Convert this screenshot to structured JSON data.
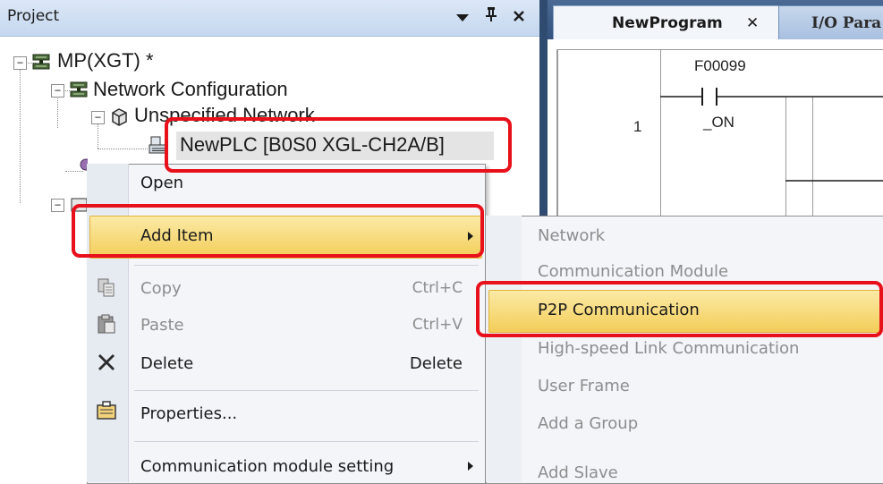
{
  "project_pane": {
    "title": "Project",
    "buttons": [
      "▼",
      "ᵖ",
      "✕"
    ]
  },
  "tree": {
    "root": "MP(XGT) *",
    "network_config": "Network Configuration",
    "unspecified_network": "Unspecified Network",
    "plc": "NewPLC  [B0S0 XGL-CH2A/B]"
  },
  "editor": {
    "tabs": [
      {
        "label": "NewProgram",
        "close": "✕"
      },
      {
        "label": "I/O Para"
      }
    ],
    "rung_number": "1",
    "contact_address": "F00099",
    "contact_name": "_ON"
  },
  "context_menu": {
    "items": [
      {
        "label": "Open",
        "shortcut": "",
        "disabled": false,
        "icon": ""
      },
      {
        "label": "Add Item",
        "shortcut": "",
        "disabled": false,
        "highlighted": true,
        "submenu": true,
        "icon": ""
      },
      {
        "label": "Copy",
        "shortcut": "Ctrl+C",
        "disabled": true,
        "icon": "copy-icon"
      },
      {
        "label": "Paste",
        "shortcut": "Ctrl+V",
        "disabled": true,
        "icon": "paste-icon"
      },
      {
        "label": "Delete",
        "shortcut": "Delete",
        "disabled": false,
        "icon": "delete-x-icon"
      },
      {
        "label": "Properties...",
        "shortcut": "",
        "disabled": false,
        "icon": "properties-icon"
      },
      {
        "label": "Communication module setting",
        "shortcut": "",
        "disabled": false,
        "submenu": true,
        "icon": ""
      }
    ]
  },
  "submenu": {
    "items": [
      {
        "label": "Network",
        "disabled": true
      },
      {
        "label": "Communication Module",
        "disabled": true
      },
      {
        "label": "P2P Communication",
        "disabled": false,
        "highlighted": true
      },
      {
        "label": "High-speed Link Communication",
        "disabled": true
      },
      {
        "label": "User Frame",
        "disabled": true
      },
      {
        "label": "Add a Group",
        "disabled": true
      },
      {
        "label": "Add Slave",
        "disabled": true
      }
    ]
  },
  "colors": {
    "highlight": "#f3cd58",
    "annotation": "#e8101a",
    "header_dark": "#33527d"
  }
}
